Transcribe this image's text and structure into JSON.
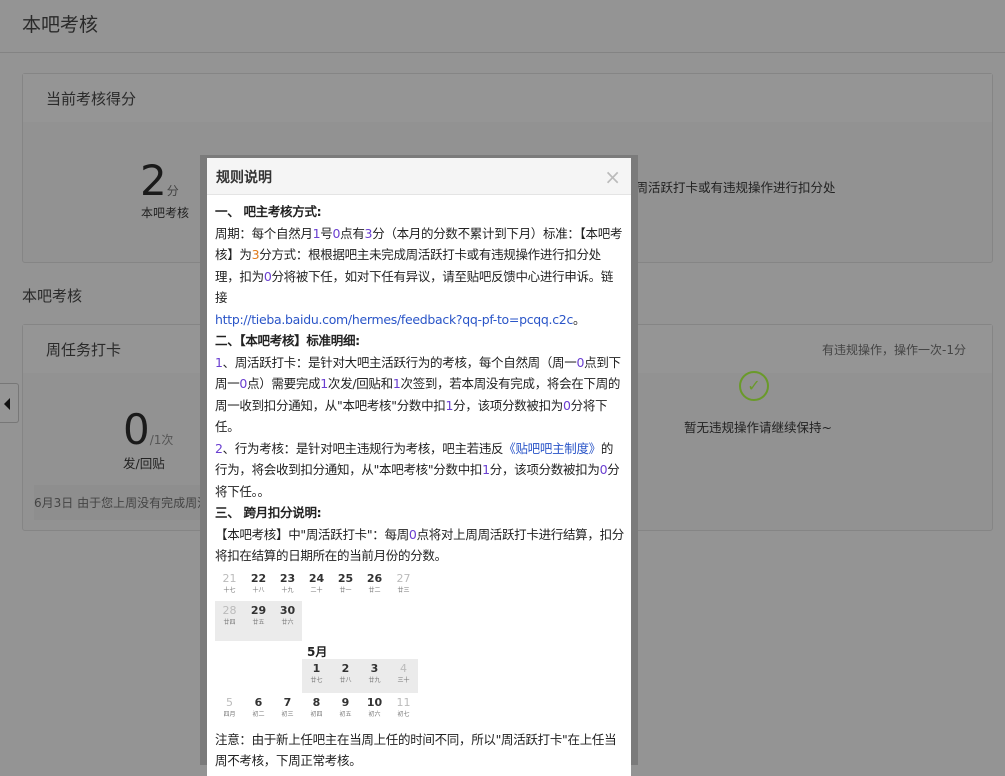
{
  "page": {
    "title": "本吧考核",
    "section_title": "本吧考核"
  },
  "score_card": {
    "title": "当前考核得分",
    "score": "2",
    "unit": "分",
    "label": "本吧考核",
    "desc_partial": "或周活跃打卡或有违规操作进行扣分处"
  },
  "weekly_card": {
    "title": "周任务打卡",
    "count": "0",
    "count_unit": "/1次",
    "count_label": "发/回贴",
    "notice": "6月3日  由于您上周没有完成周活",
    "right_hint": "有违规操作，操作一次-1分",
    "ok_text": "暂无违规操作请继续保持~"
  },
  "modal": {
    "title": "规则说明",
    "close": "×",
    "s1_title": "一、 吧主考核方式:",
    "s1_p": [
      "周期：每个自然月",
      "1",
      "号",
      "0",
      "点有",
      "3",
      "分（本月的分数不累计到下月）标准：【本吧考核】为",
      "3",
      "分方式：根根据吧主未完成周活跃打卡或有违规操作进行扣分处理，扣为",
      "0",
      "分将被下任，如对下任有异议，请至贴吧反馈中心进行申诉。链接"
    ],
    "s1_link": "http://tieba.baidu.com/hermes/feedback?qq-pf-to=pcqq.c2c",
    "s1_end": "。",
    "s2_title": "二、【本吧考核】标准明细:",
    "s2_item1": [
      "1",
      "、周活跃打卡：是针对大吧主活跃行为的考核，每个自然周（周一",
      "0",
      "点到下周一",
      "0",
      "点）需要完成",
      "1",
      "次发/回贴和",
      "1",
      "次签到，若本周没有完成，将会在下周的周一收到扣分通知，从\"本吧考核\"分数中扣",
      "1",
      "分，该项分数被扣为",
      "0",
      "分将下任。"
    ],
    "s2_item2": [
      "2",
      "、行为考核：是针对吧主违规行为考核，吧主若违反",
      "《贴吧吧主制度》",
      "的行为，将会收到扣分通知，从\"本吧考核\"分数中扣",
      "1",
      "分，该项分数被扣为",
      "0",
      "分将下任。。"
    ],
    "s3_title": "三、 跨月扣分说明:",
    "s3_p": [
      "【本吧考核】中\"周活跃打卡\"：每周",
      "0",
      "点将对上周周活跃打卡进行结算，扣分将扣在结算的日期所在的当前月份的分数。"
    ],
    "calendar": {
      "month_label": "5月",
      "rows": [
        [
          [
            "21",
            "十七"
          ],
          [
            "22",
            "十八"
          ],
          [
            "23",
            "十九"
          ],
          [
            "24",
            "二十"
          ],
          [
            "25",
            "廿一"
          ],
          [
            "26",
            "廿二"
          ],
          [
            "27",
            "廿三"
          ]
        ],
        [
          [
            "28",
            "廿四"
          ],
          [
            "29",
            "廿五"
          ],
          [
            "30",
            "廿六"
          ]
        ],
        [
          [
            "1",
            "廿七"
          ],
          [
            "2",
            "廿八"
          ],
          [
            "3",
            "廿九"
          ],
          [
            "4",
            "三十"
          ]
        ],
        [
          [
            "5",
            "四月"
          ],
          [
            "6",
            "初二"
          ],
          [
            "7",
            "初三"
          ],
          [
            "8",
            "初四"
          ],
          [
            "9",
            "初五"
          ],
          [
            "10",
            "初六"
          ],
          [
            "11",
            "初七"
          ]
        ]
      ]
    },
    "note": "注意：由于新上任吧主在当周上任的时间不同，所以\"周活跃打卡\"在上任当周不考核，下周正常考核。"
  },
  "colors": {
    "link": "#2a55c8",
    "number": "#6a3fd0",
    "check": "#6a9a2a"
  }
}
